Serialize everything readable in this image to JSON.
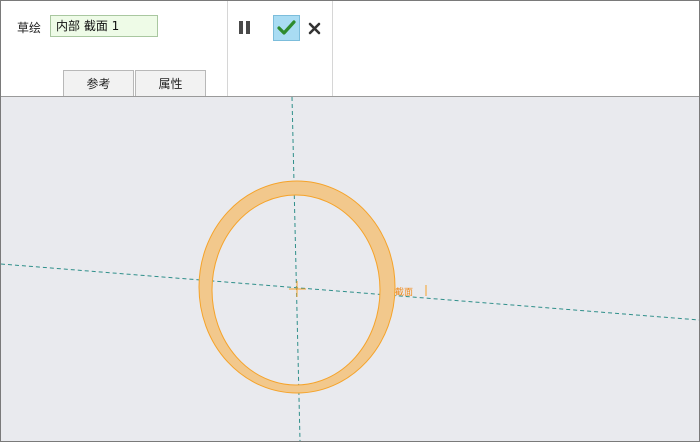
{
  "ribbon": {
    "sketch_label": "草绘",
    "sketch_value": "内部 截面 1",
    "tabs": [
      {
        "label": "参考"
      },
      {
        "label": "属性"
      }
    ],
    "pause_icon": "pause-icon",
    "ok_icon": "checkmark-icon",
    "cancel_icon": "close-x-icon"
  },
  "canvas": {
    "section_label": "截面",
    "colors": {
      "background": "#e9eaee",
      "ring_fill": "#f2c88c",
      "ring_stroke": "#f5a32a",
      "centerline": "#2f8f8a",
      "ok_button": "#a9dcf3"
    }
  }
}
